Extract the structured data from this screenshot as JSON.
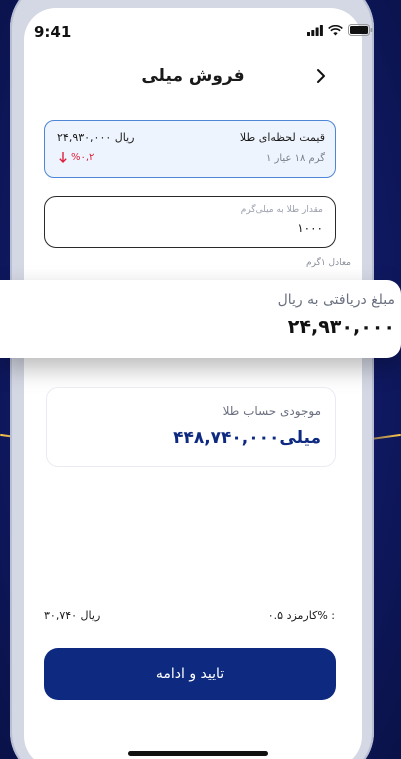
{
  "status_bar": {
    "time": "9:41"
  },
  "header": {
    "title": "فروش میلی"
  },
  "price_card": {
    "title": "قیمت لحظه‌ای طلا",
    "subtitle": "۱ گرم ۱۸ عیار",
    "value": "۲۴,۹۳۰,۰۰۰ ریال",
    "change": "%۰,۲",
    "change_color": "#e0203d"
  },
  "amount_field": {
    "label": "مقدار طلا به میلی‌گرم",
    "value": "۱۰۰۰"
  },
  "equivalent": "معادل ۱گرم",
  "received_amount": {
    "title": "مبلغ دریافتی به ریال",
    "value": "۲۴,۹۳۰,۰۰۰"
  },
  "gold_balance": {
    "title": "موجودی حساب طلا",
    "value": "۴۴۸,۷۴۰,۰۰۰میلی"
  },
  "fee": {
    "label": "کارمزد ۰.۵% :",
    "value": "۳۰,۷۴۰ ریال"
  },
  "confirm_button": {
    "label": "تایید و ادامه",
    "color": "#0d2a80"
  },
  "icons": {
    "back": "chevron-right-icon",
    "change_direction": "arrow-down-icon"
  }
}
